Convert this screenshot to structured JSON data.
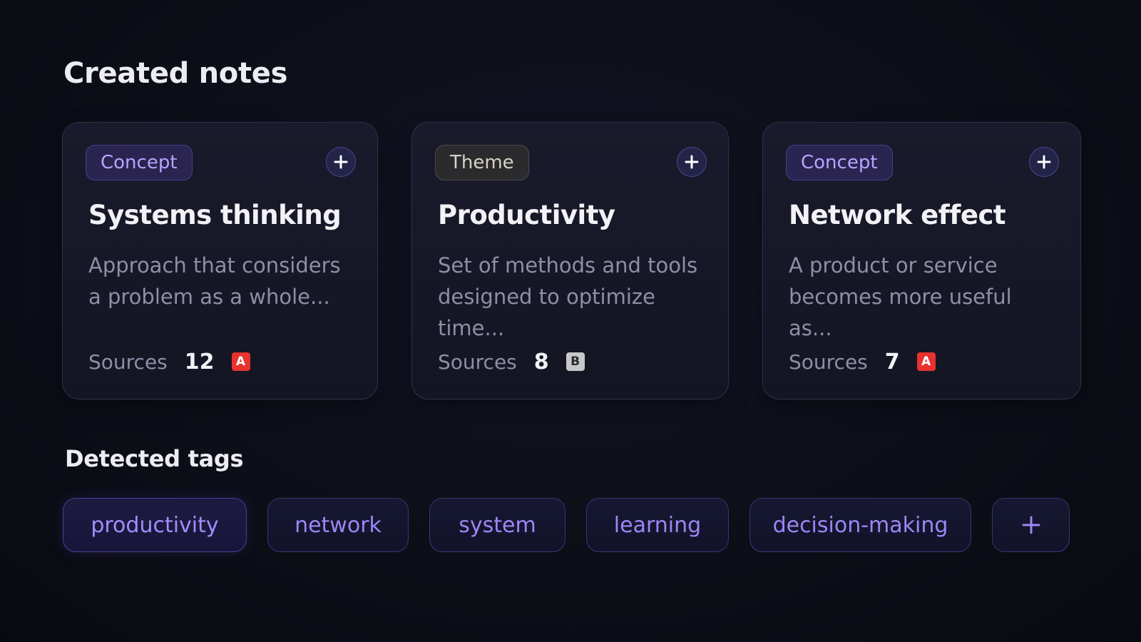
{
  "sections": {
    "created_notes_title": "Created notes",
    "detected_tags_title": "Detected tags"
  },
  "cards": [
    {
      "badge": "Concept",
      "badge_kind": "concept",
      "title": "Systems thinking",
      "description": "Approach that considers a problem as a whole...",
      "sources_label": "Sources",
      "sources_count": "12",
      "source_icon": "A",
      "source_icon_color": "#e8322f"
    },
    {
      "badge": "Theme",
      "badge_kind": "theme",
      "title": "Productivity",
      "description": "Set of methods and tools designed to optimize time...",
      "sources_label": "Sources",
      "sources_count": "8",
      "source_icon": "B",
      "source_icon_color": "#c8c8cc"
    },
    {
      "badge": "Concept",
      "badge_kind": "concept",
      "title": "Network effect",
      "description": "A product or service becomes more useful as...",
      "sources_label": "Sources",
      "sources_count": "7",
      "source_icon": "A",
      "source_icon_color": "#e8322f"
    }
  ],
  "tags": [
    "productivity",
    "network",
    "system",
    "learning",
    "decision-making"
  ],
  "add_tag_icon": "plus-icon",
  "colors": {
    "accent": "#9d86f5",
    "background": "#0c0e17",
    "card_border": "#2e2f48"
  }
}
